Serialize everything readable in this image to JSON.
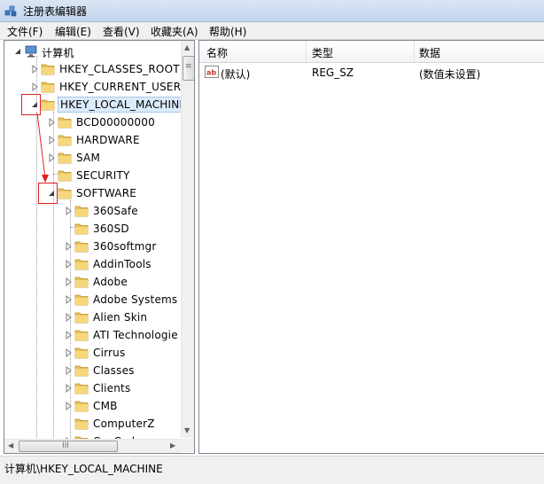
{
  "window": {
    "title": "注册表编辑器"
  },
  "menu": [
    "文件(F)",
    "编辑(E)",
    "查看(V)",
    "收藏夹(A)",
    "帮助(H)"
  ],
  "tree": {
    "root": "计算机",
    "hives": [
      "HKEY_CLASSES_ROOT",
      "HKEY_CURRENT_USER",
      "HKEY_LOCAL_MACHINE"
    ],
    "hklm_children": [
      "BCD00000000",
      "HARDWARE",
      "SAM",
      "SECURITY",
      "SOFTWARE"
    ],
    "software_children": [
      "360Safe",
      "360SD",
      "360softmgr",
      "AddinTools",
      "Adobe",
      "Adobe Systems",
      "Alien Skin",
      "ATI Technologie",
      "Cirrus",
      "Classes",
      "Clients",
      "CMB",
      "ComputerZ",
      "CyaCodec"
    ]
  },
  "list": {
    "columns": [
      "名称",
      "类型",
      "数据"
    ],
    "rows": [
      {
        "name": "(默认)",
        "type": "REG_SZ",
        "data": "(数值未设置)",
        "icon": "reg-sz-icon"
      }
    ]
  },
  "status": {
    "path": "计算机\\HKEY_LOCAL_MACHINE"
  },
  "scrollbar": {
    "h_grip": "III",
    "v_grip": "≡"
  },
  "colors": {
    "selection": "#dcebfc",
    "annotation": "#e02020",
    "folder": "#e8c25a"
  }
}
